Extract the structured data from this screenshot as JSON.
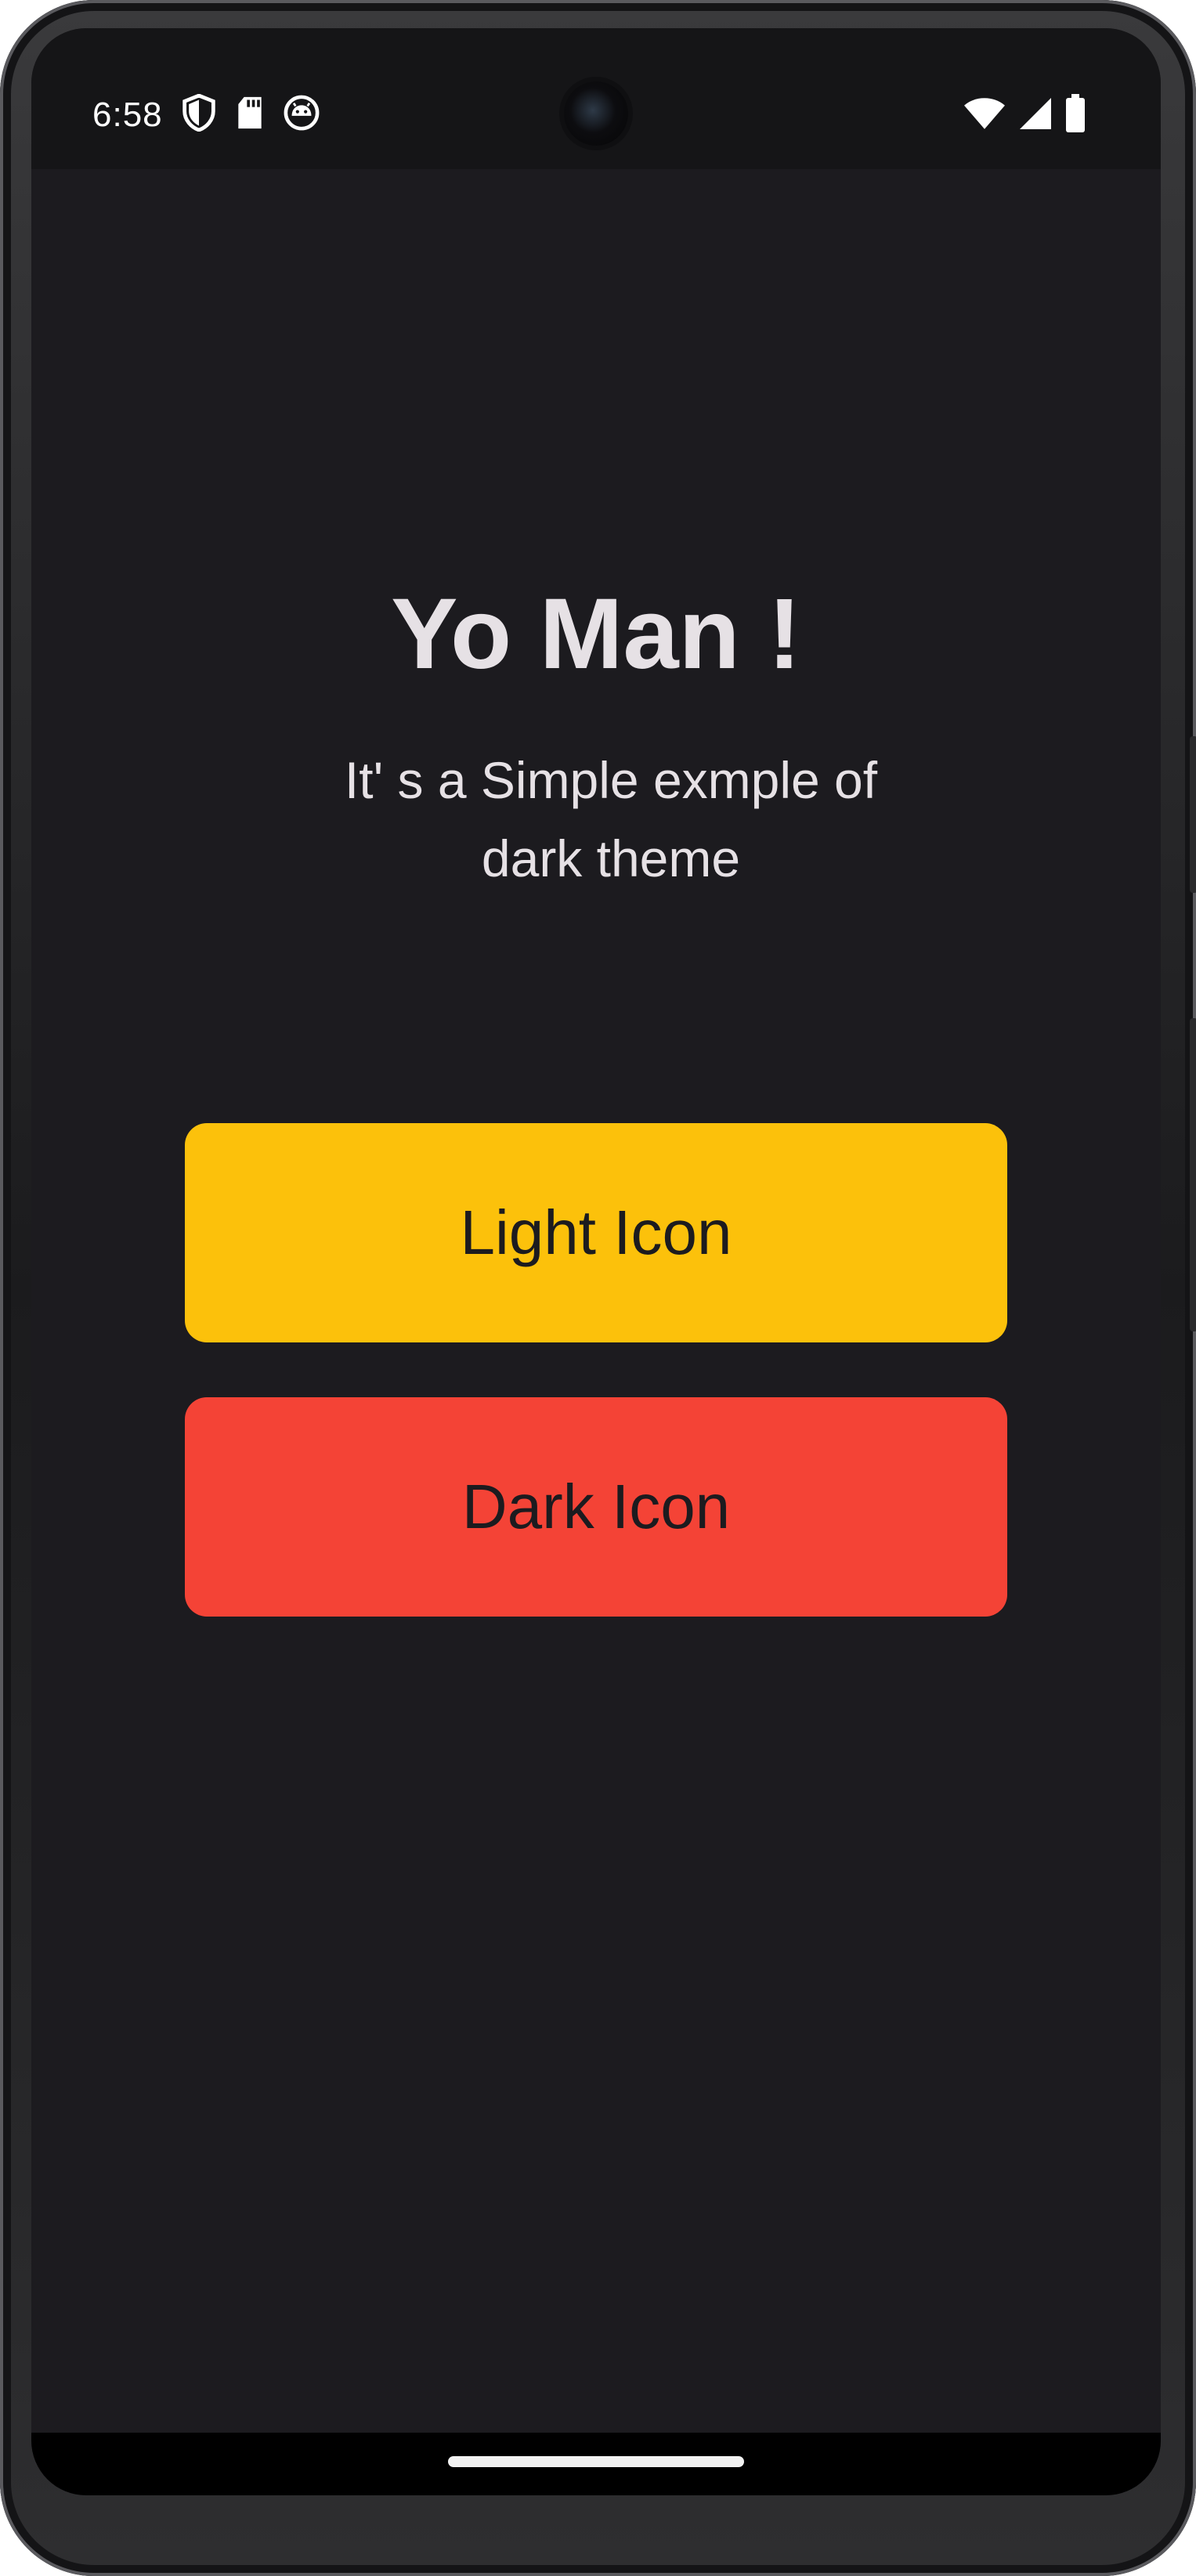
{
  "status_bar": {
    "time": "6:58",
    "left_icons": [
      "shield-icon",
      "sd-card-icon",
      "debug-robot-icon"
    ],
    "right_icons": [
      "wifi-icon",
      "cell-signal-icon",
      "battery-icon"
    ]
  },
  "main": {
    "title": "Yo Man !",
    "subtitle_line1": "It' s a Simple exmple of",
    "subtitle_line2": "dark theme"
  },
  "buttons": {
    "light": {
      "label": "Light Icon",
      "color": "#fcc10b"
    },
    "dark": {
      "label": "Dark Icon",
      "color": "#f44336"
    }
  },
  "theme": {
    "background": "#1c1b1f",
    "text": "#e6e1e5"
  }
}
